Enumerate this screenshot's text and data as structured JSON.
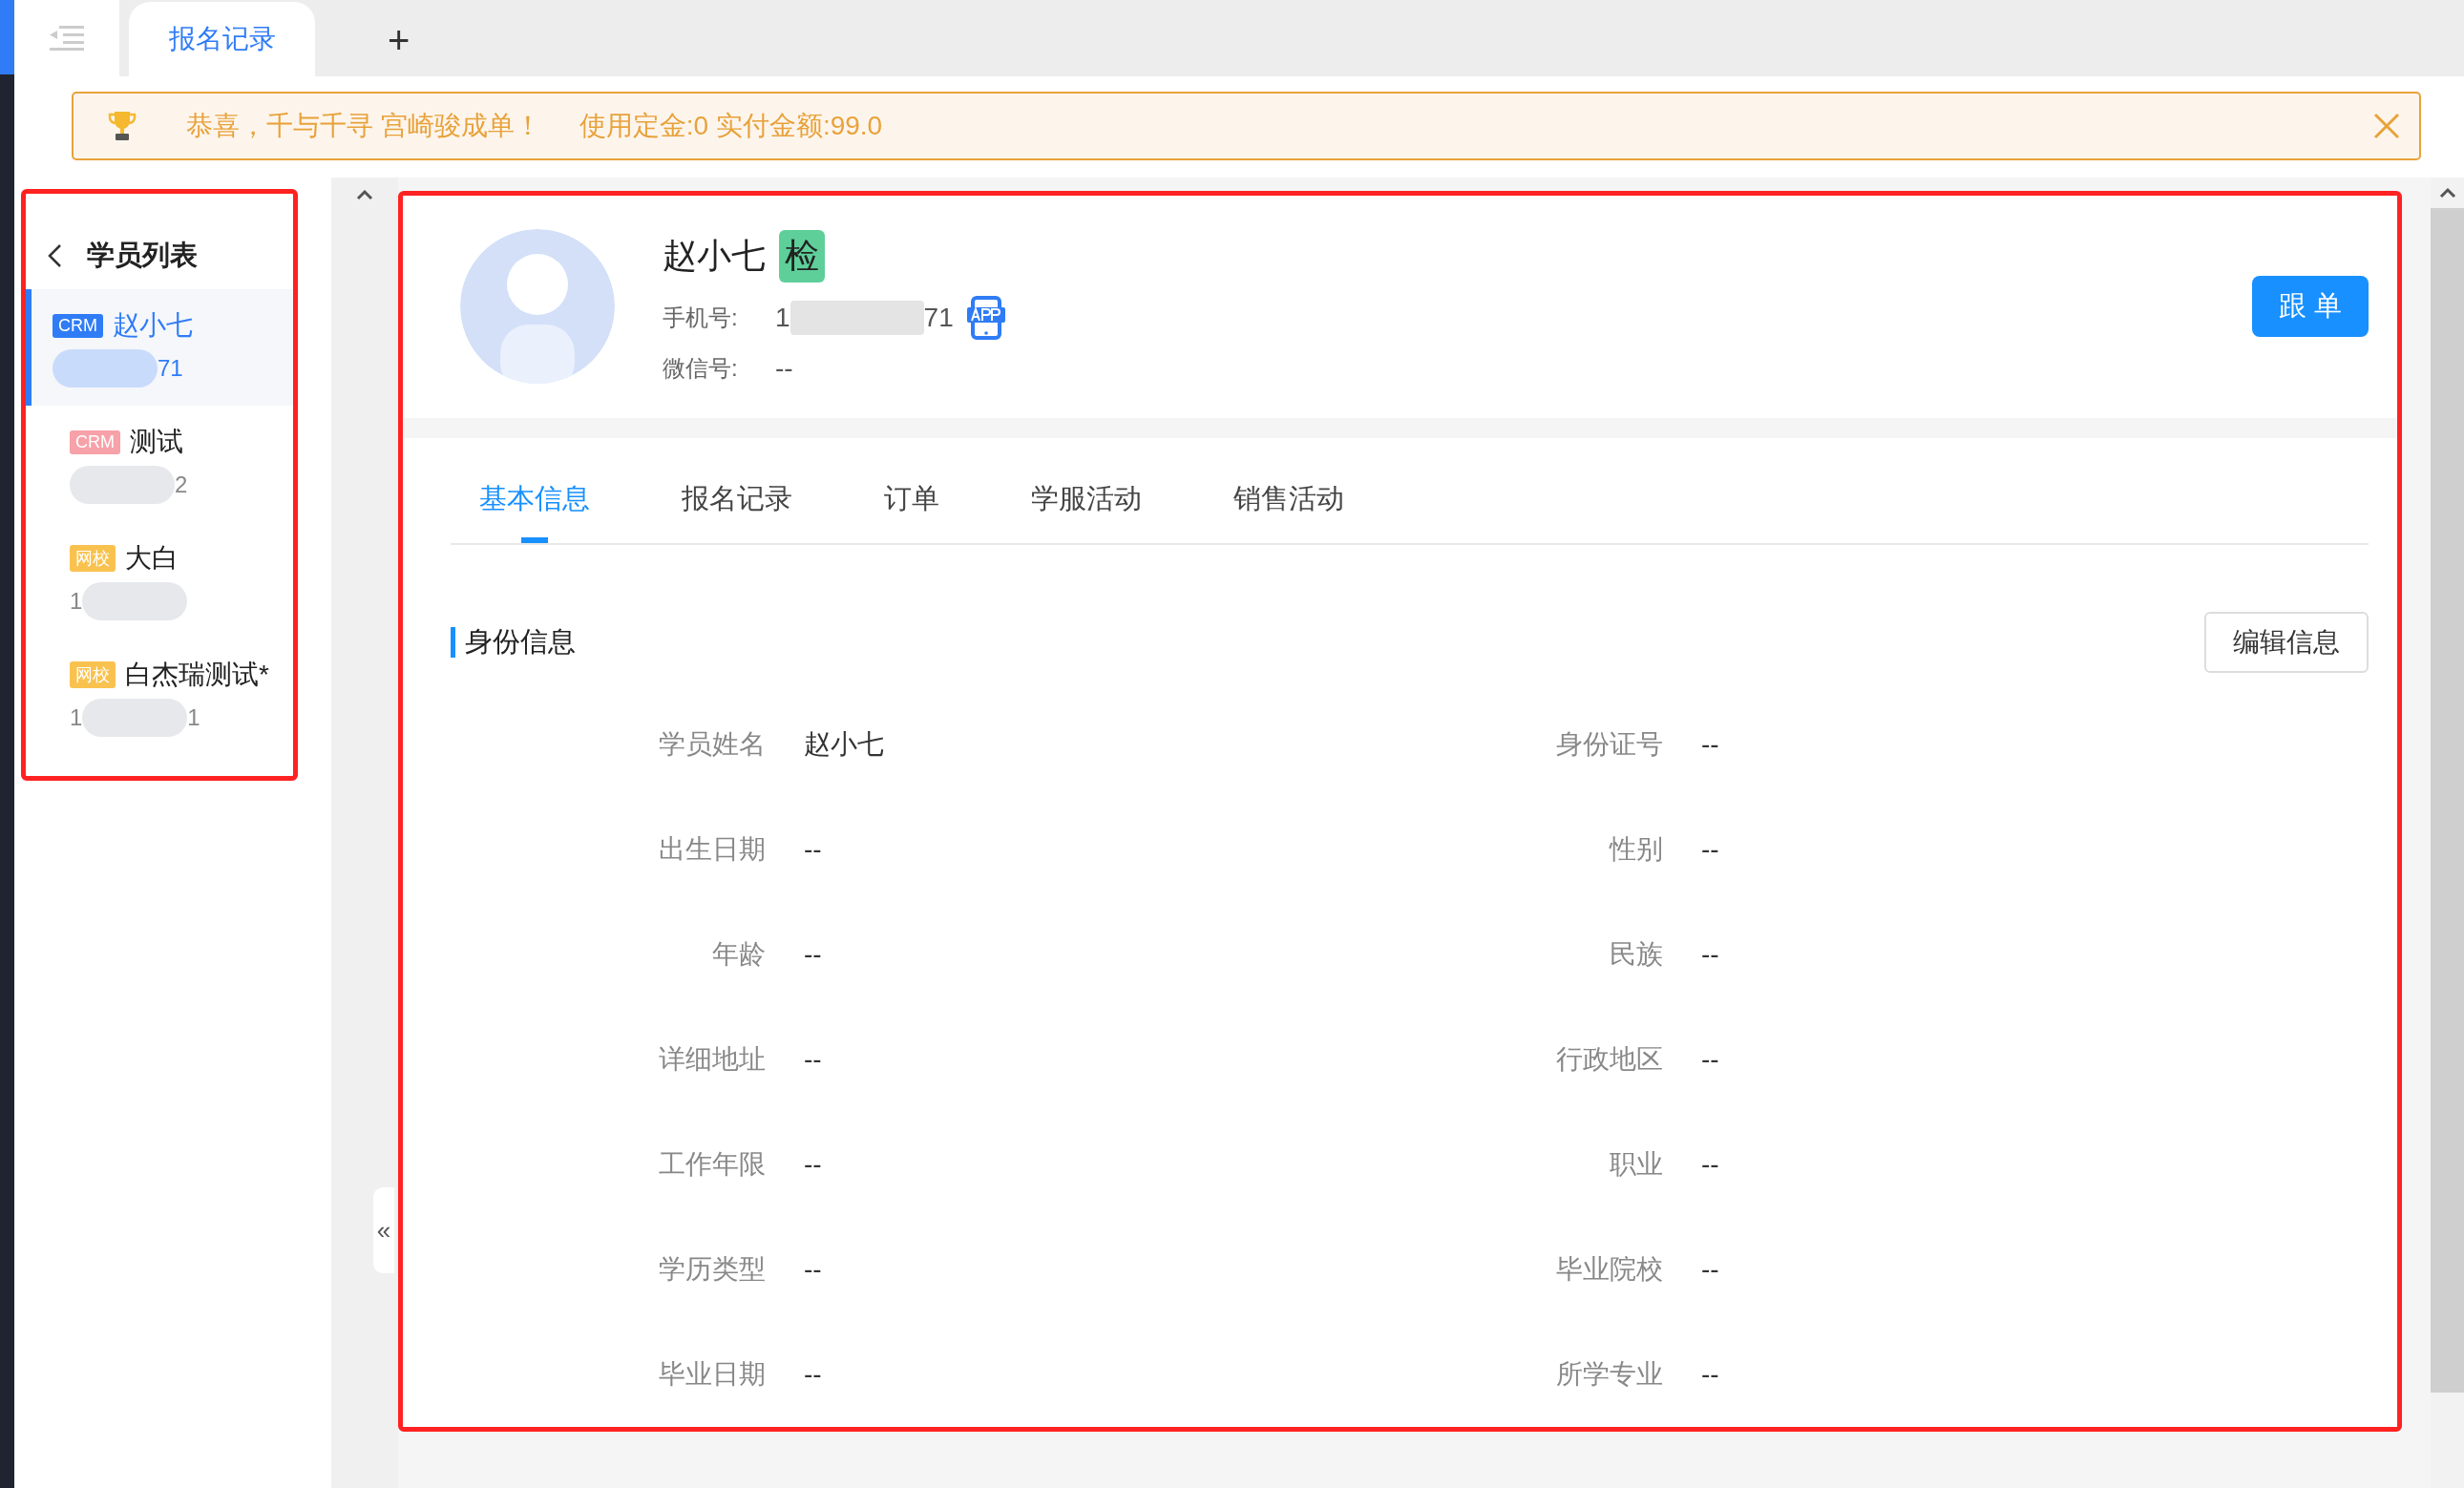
{
  "app_tabs": [
    {
      "label": "报名记录",
      "selected": true
    }
  ],
  "new_tab": "+",
  "banner": {
    "message": "恭喜，千与千寻  宫崎骏成单！",
    "amounts": "使用定金:0 实付金额:99.0"
  },
  "student_list": {
    "title": "学员列表",
    "items": [
      {
        "tag": "CRM",
        "color": "#2f7cf6",
        "name": "赵小七",
        "phone_parts": [
          {
            "kind": "mask"
          },
          {
            "kind": "text",
            "text": "71"
          }
        ],
        "selected": true
      },
      {
        "tag": "CRM",
        "color": "#f7a1a8",
        "name": "测试",
        "phone_parts": [
          {
            "kind": "mask"
          },
          {
            "kind": "text",
            "text": "2"
          }
        ],
        "selected": false
      },
      {
        "tag": "网校",
        "color": "#f9c24f",
        "name": "大白",
        "phone_parts": [
          {
            "kind": "text",
            "text": "1"
          },
          {
            "kind": "mask"
          }
        ],
        "selected": false
      },
      {
        "tag": "网校",
        "color": "#f9c24f",
        "name": "白杰瑞测试*",
        "phone_parts": [
          {
            "kind": "text",
            "text": "1"
          },
          {
            "kind": "mask"
          },
          {
            "kind": "text",
            "text": "1"
          }
        ],
        "selected": false
      }
    ]
  },
  "collapse_handle": "«",
  "profile": {
    "name": "赵小七",
    "badge": "检",
    "phone_label": "手机号:",
    "phone_parts": [
      "1",
      "71"
    ],
    "wechat_label": "微信号:",
    "wechat": "--",
    "follow_button": "跟单"
  },
  "tabs": [
    {
      "label": "基本信息",
      "selected": true
    },
    {
      "label": "报名记录",
      "selected": false
    },
    {
      "label": "订单",
      "selected": false
    },
    {
      "label": "学服活动",
      "selected": false
    },
    {
      "label": "销售活动",
      "selected": false
    }
  ],
  "section": {
    "title": "身份信息",
    "edit_button": "编辑信息"
  },
  "fields": [
    {
      "label": "学员姓名",
      "value": "赵小七"
    },
    {
      "label": "身份证号",
      "value": "--"
    },
    {
      "label": "出生日期",
      "value": "--"
    },
    {
      "label": "性别",
      "value": "--"
    },
    {
      "label": "年龄",
      "value": "--"
    },
    {
      "label": "民族",
      "value": "--"
    },
    {
      "label": "详细地址",
      "value": "--"
    },
    {
      "label": "行政地区",
      "value": "--"
    },
    {
      "label": "工作年限",
      "value": "--"
    },
    {
      "label": "职业",
      "value": "--"
    },
    {
      "label": "学历类型",
      "value": "--"
    },
    {
      "label": "毕业院校",
      "value": "--"
    },
    {
      "label": "毕业日期",
      "value": "--"
    },
    {
      "label": "所学专业",
      "value": "--"
    }
  ]
}
